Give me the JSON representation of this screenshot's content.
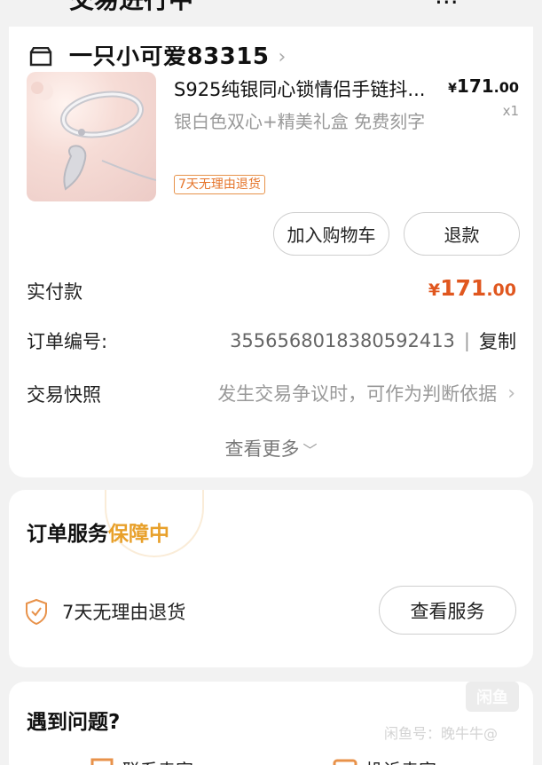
{
  "header": {
    "title": "交易进行中",
    "right": "..."
  },
  "shop": {
    "name": "一只小可爱83315"
  },
  "product": {
    "title": "S925纯银同心锁情侣手链抖...",
    "price_yen": "¥",
    "price_int": "171",
    "price_dec": ".00",
    "qty": "x1",
    "spec": "银白色双心+精美礼盒 免费刻字",
    "return_tag": "7天无理由退货",
    "add_cart": "加入购物车",
    "refund": "退款"
  },
  "order": {
    "paid_label": "实付款",
    "paid_yen": "¥",
    "paid_int": "171",
    "paid_dec": ".00",
    "number_label": "订单编号:",
    "number_value": "3556568018380592413",
    "copy": "复制",
    "snapshot_label": "交易快照",
    "snapshot_value": "发生交易争议时，可作为判断依据",
    "see_more": "查看更多"
  },
  "service": {
    "title": "订单服务",
    "status": "保障中",
    "item_label": "7天无理由退货",
    "view_button": "查看服务"
  },
  "problem": {
    "title": "遇到问题?",
    "watermark_logo": "闲鱼",
    "watermark_text": "闲鱼号：晚牛牛@",
    "item1": "联系卖家",
    "item2": "投诉卖家"
  },
  "colors": {
    "accent_orange": "#e0571f",
    "guard_gold": "#e8a02a"
  }
}
